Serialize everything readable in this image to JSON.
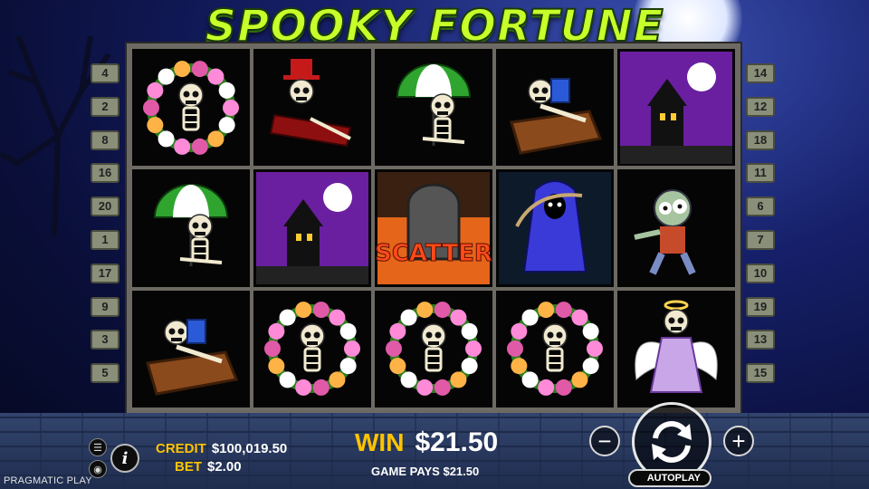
{
  "title": "SPOOKY FORTUNE",
  "reels": [
    [
      "skeleton-wreath",
      "skeleton-umbrella",
      "skeleton-coffin"
    ],
    [
      "skeleton-top-hat",
      "haunted-house",
      "skeleton-wreath"
    ],
    [
      "skeleton-umbrella",
      "scatter-tombstone",
      "skeleton-wreath"
    ],
    [
      "skeleton-coffin",
      "grim-reaper",
      "skeleton-wreath"
    ],
    [
      "haunted-house",
      "zombie",
      "skeleton-angel"
    ]
  ],
  "scatter_label": "SCATTER",
  "paylines_left": [
    "4",
    "2",
    "8",
    "16",
    "20",
    "1",
    "17",
    "9",
    "3",
    "5"
  ],
  "paylines_right": [
    "14",
    "12",
    "18",
    "11",
    "6",
    "7",
    "10",
    "19",
    "13",
    "15"
  ],
  "footer": {
    "credit_label": "CREDIT",
    "credit_value": "$100,019.50",
    "bet_label": "BET",
    "bet_value": "$2.00",
    "win_label": "WIN",
    "win_value": "$21.50",
    "game_pays": "GAME PAYS $21.50",
    "autoplay_label": "AUTOPLAY",
    "provider": "PRAGMATIC PLAY",
    "info_glyph": "i",
    "minus_glyph": "−",
    "plus_glyph": "+"
  },
  "colors": {
    "title": "#c6ff2a",
    "label_yellow": "#ffc400",
    "scatter": "#ff4a1a"
  }
}
